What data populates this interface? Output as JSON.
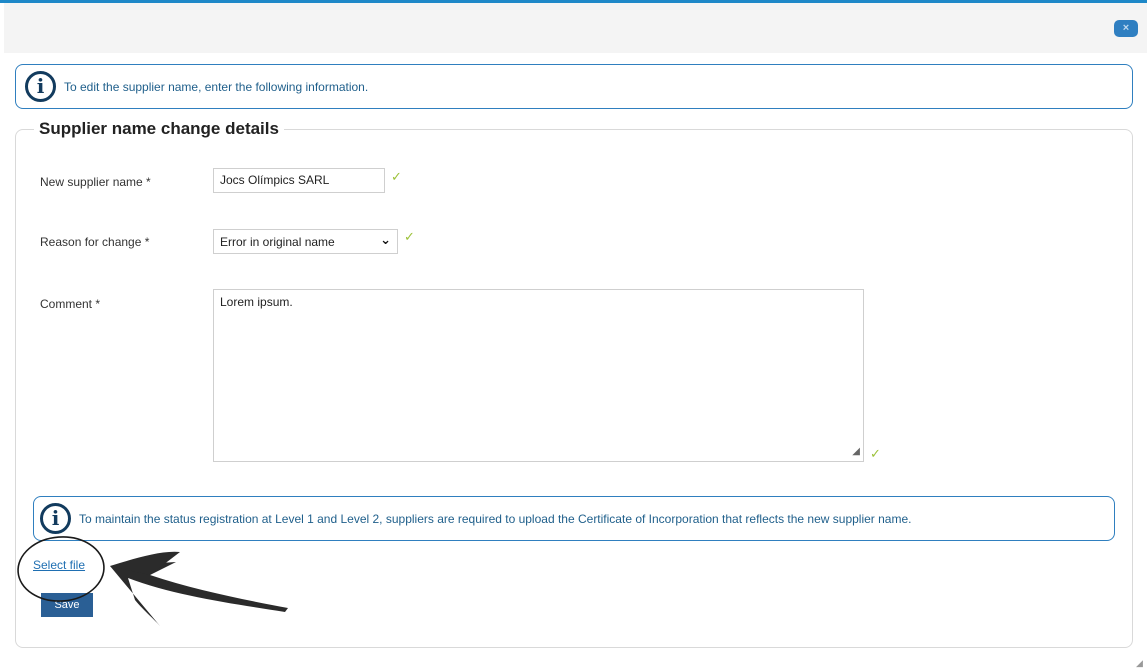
{
  "dialog": {
    "close_label": "×"
  },
  "info_top": {
    "text": "To edit the supplier name, enter the following information."
  },
  "form": {
    "legend": "Supplier name change details",
    "new_name_label": "New supplier name *",
    "new_name_value": "Jocs Olímpics SARL",
    "reason_label": "Reason for change *",
    "reason_selected": "Error in original name",
    "comment_label": "Comment *",
    "comment_value": "Lorem ipsum."
  },
  "info_bottom": {
    "text": "To maintain the status registration at Level 1 and Level 2, suppliers are required to upload the Certificate of Incorporation that reflects the new supplier name."
  },
  "actions": {
    "select_file_label": "Select file",
    "save_label": "Save"
  },
  "icons": {
    "info": "info-icon",
    "check": "checkmark-icon",
    "close": "close-icon"
  },
  "colors": {
    "accent": "#1e88c8",
    "info_border": "#2f7fbf",
    "check": "#9dc23a",
    "save_button": "#2a5f95"
  }
}
